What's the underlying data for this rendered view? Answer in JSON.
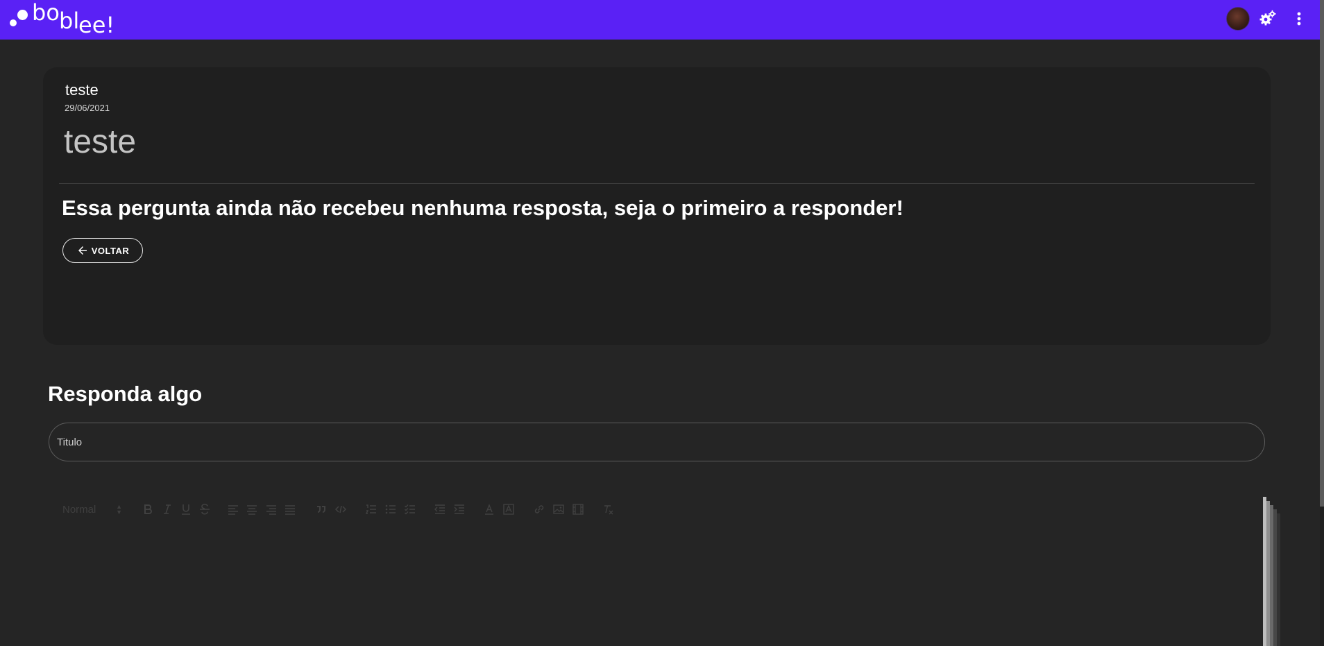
{
  "header": {
    "logo_parts": [
      "bo",
      "bl",
      "ee!"
    ],
    "brand_color": "#5a21f5",
    "icons": [
      "avatar",
      "gears-icon",
      "more-vert-icon"
    ]
  },
  "question": {
    "author": "teste",
    "date": "29/06/2021",
    "title": "teste",
    "no_answer_message": "Essa pergunta ainda não recebeu nenhuma resposta, seja o primeiro a responder!",
    "back_button_label": "VOLTAR"
  },
  "answer_form": {
    "section_title": "Responda algo",
    "title_placeholder": "Titulo",
    "editor": {
      "format_selected": "Normal",
      "tools": [
        "bold-icon",
        "italic-icon",
        "underline-icon",
        "strike-icon",
        "align-left-icon",
        "align-center-icon",
        "align-right-icon",
        "align-justify-icon",
        "blockquote-icon",
        "code-block-icon",
        "ordered-list-icon",
        "bullet-list-icon",
        "check-list-icon",
        "indent-decrease-icon",
        "indent-increase-icon",
        "text-color-icon",
        "background-color-icon",
        "link-icon",
        "image-icon",
        "video-icon",
        "clear-format-icon"
      ]
    }
  }
}
